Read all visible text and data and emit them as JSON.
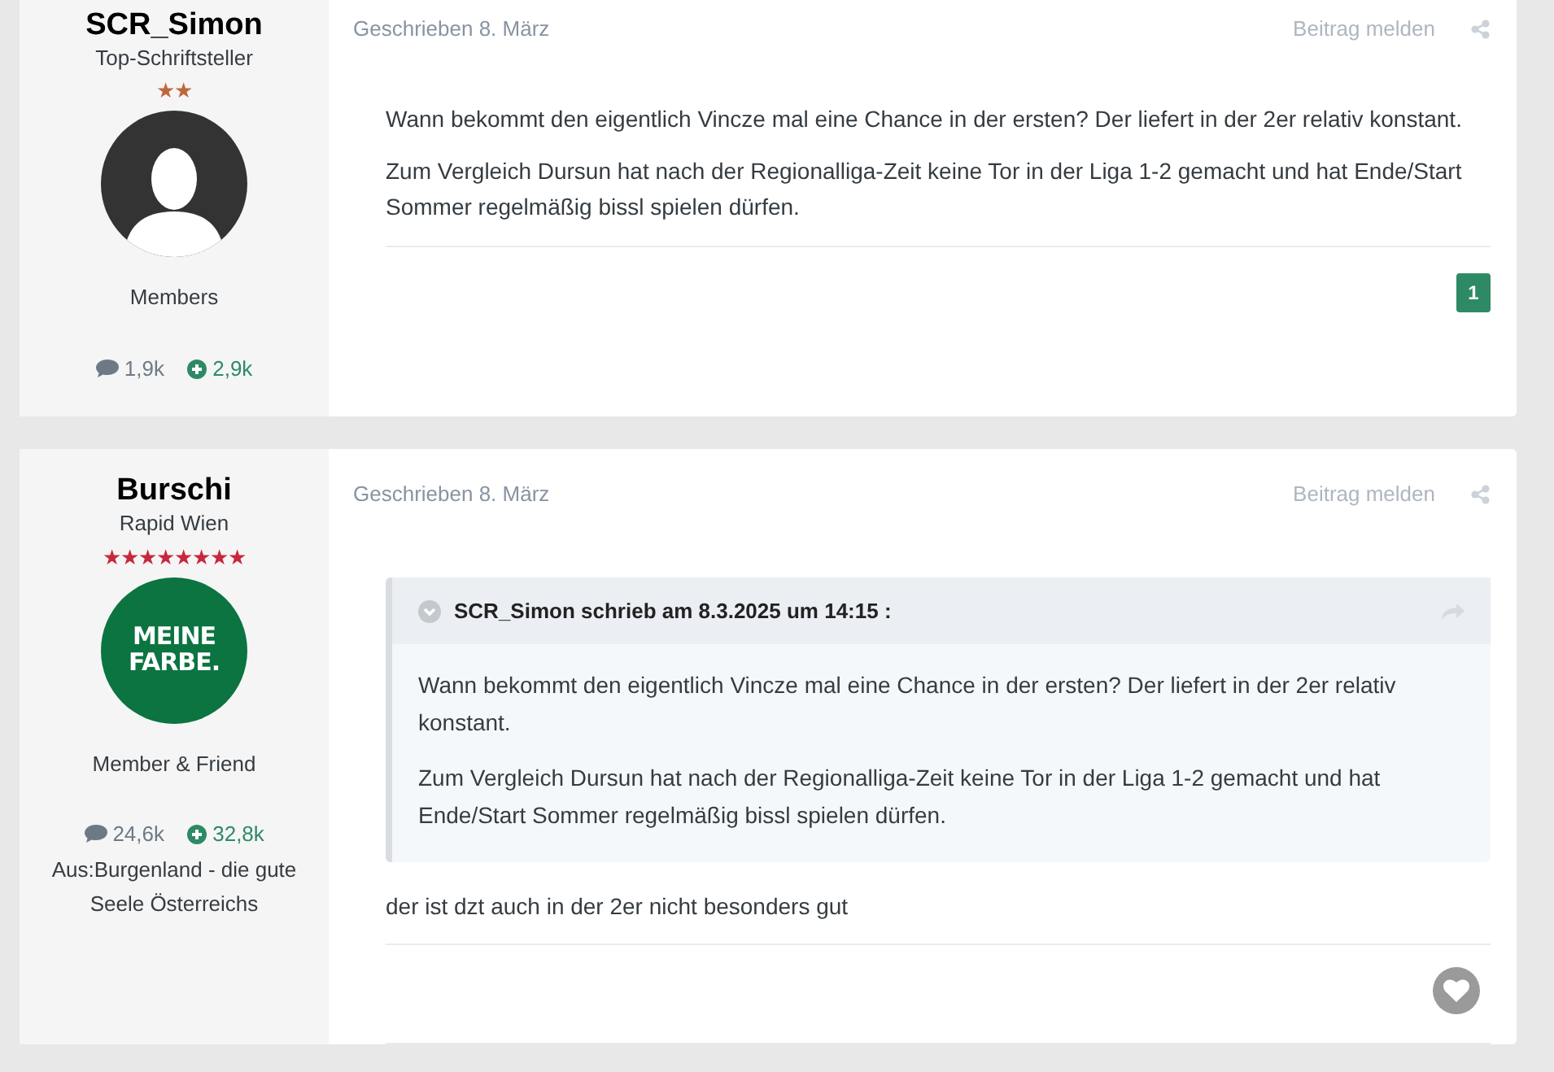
{
  "posts": [
    {
      "author": {
        "name": "SCR_Simon",
        "title": "Top-Schriftsteller",
        "rank_stars": "★★",
        "color": "#c0663c",
        "avatar": {
          "kind": "silhouette"
        },
        "group": "Members",
        "posts_count": "1,9k",
        "reputation": "2,9k"
      },
      "date": "Geschrieben 8. März",
      "report": "Beitrag melden",
      "paragraphs": [
        "Wann bekommt den eigentlich Vincze mal eine Chance in der ersten? Der liefert in der 2er relativ konstant.",
        "Zum Vergleich Dursun hat nach der Regionalliga-Zeit keine Tor in der Liga 1-2 gemacht und hat Ende/Start Sommer regelmäßig bissl spielen dürfen."
      ],
      "reaction_count": "1"
    },
    {
      "author": {
        "name": "Burschi",
        "title": "Rapid Wien",
        "rank_stars": "★★★★★★★★",
        "color": "#c8283c",
        "avatar": {
          "kind": "logo",
          "text": "MEINE FARBE."
        },
        "group": "Member & Friend",
        "posts_count": "24,6k",
        "reputation": "32,8k",
        "location": "Aus:Burgenland - die gute Seele Österreichs"
      },
      "date": "Geschrieben 8. März",
      "report": "Beitrag melden",
      "quote": {
        "header": "SCR_Simon schrieb am 8.3.2025 um 14:15 :",
        "paragraphs": [
          "Wann bekommt den eigentlich Vincze mal eine Chance in der ersten? Der liefert in der 2er relativ konstant.",
          "Zum Vergleich Dursun hat nach der Regionalliga-Zeit keine Tor in der Liga 1-2 gemacht und hat Ende/Start Sommer regelmäßig bissl spielen dürfen."
        ]
      },
      "paragraphs": [
        "der ist dzt auch in der 2er nicht besonders gut"
      ],
      "like": true
    }
  ]
}
